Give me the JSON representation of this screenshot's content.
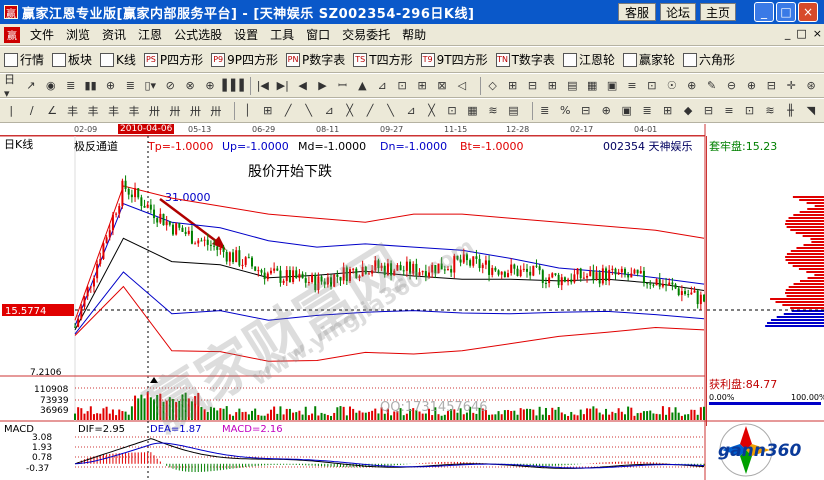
{
  "window": {
    "title": "赢家江恩专业版[赢家内部服务平台] - [天神娱乐  SZ002354-296日K线]",
    "buttons": [
      "客服",
      "论坛",
      "主页"
    ],
    "controls": [
      "_",
      "□",
      "×"
    ]
  },
  "menu": {
    "items": [
      "文件",
      "浏览",
      "资讯",
      "江恩",
      "公式选股",
      "设置",
      "工具",
      "窗口",
      "交易委托",
      "帮助"
    ],
    "right_controls": [
      "_",
      "□",
      "×"
    ]
  },
  "toolbar1": {
    "items": [
      {
        "label": "行情",
        "icon": "grid-icon"
      },
      {
        "label": "板块",
        "icon": "blocks-icon"
      },
      {
        "label": "K线",
        "icon": "candles-icon"
      },
      {
        "label": "P四方形",
        "icon": "ps-icon",
        "badge": "PS"
      },
      {
        "label": "9P四方形",
        "icon": "p9-icon",
        "badge": "P9"
      },
      {
        "label": "P数字表",
        "icon": "pn-icon",
        "badge": "PN"
      },
      {
        "label": "T四方形",
        "icon": "ts-icon",
        "badge": "TS"
      },
      {
        "label": "9T四方形",
        "icon": "t9-icon",
        "badge": "T9"
      },
      {
        "label": "T数字表",
        "icon": "tn-icon",
        "badge": "TN"
      },
      {
        "label": "江恩轮",
        "icon": "wheel-icon"
      },
      {
        "label": "赢家轮",
        "icon": "wheel2-icon"
      },
      {
        "label": "六角形",
        "icon": "hexagon-icon"
      }
    ]
  },
  "toolbar2": {
    "items": [
      "日▾",
      "↗",
      "◉",
      "≣",
      "▮▮",
      "⊕",
      "≣",
      "▯▾",
      "⊘",
      "⊗",
      "⊕",
      "▐▐▐",
      "|◀",
      "▶|",
      "◀",
      "▶",
      "ꟷ",
      "▲",
      "⊿",
      "⊡",
      "⊞",
      "⊠",
      "◁",
      "◇",
      "⊞",
      "⊟",
      "⊞",
      "▤",
      "▦",
      "▣",
      "≡",
      "⊡",
      "☉",
      "⊕",
      "✎",
      "⊖",
      "⊕",
      "⊟",
      "✛",
      "⊛"
    ]
  },
  "toolbar3": {
    "items": [
      "|",
      "∕",
      "∠",
      "丰",
      "丰",
      "丰",
      "丰",
      "卅",
      "卅",
      "卅",
      "卅",
      "│",
      "⊞",
      "╱",
      "╲",
      "⊿",
      "╳",
      "╱",
      "╲",
      "⊿",
      "╳",
      "⊡",
      "▦",
      "≋",
      "▤",
      "≣",
      "%",
      "⊟",
      "⊕",
      "▣",
      "≣",
      "⊞",
      "◆",
      "⊟",
      "≡",
      "⊡",
      "≋",
      "╫",
      "◥"
    ]
  },
  "chart": {
    "period": "日K线",
    "dates": [
      "02-09",
      "2010-04-06",
      "05-13",
      "06-29",
      "08-11",
      "09-27",
      "11-15",
      "12-28",
      "02-17",
      "04-01"
    ],
    "indicator_name": "极反通道",
    "params": [
      {
        "label": "Tp=-1.0000",
        "color": "#e00000"
      },
      {
        "label": "Up=-1.0000",
        "color": "#0000c8"
      },
      {
        "label": "Md=-1.0000",
        "color": "#000000"
      },
      {
        "label": "Dn=-1.0000",
        "color": "#0000c8"
      },
      {
        "label": "Bt=-1.0000",
        "color": "#e00000"
      }
    ],
    "stock": "002354  天神娱乐",
    "annotation": "股价开始下跌",
    "peak_label": "31.0000",
    "price_tag": "15.5774",
    "volume_labels": [
      "7.2106",
      "110908",
      "73939",
      "36969"
    ],
    "qq": "QQ:1731457646",
    "watermark": "赢家财富网",
    "watermark_url": "www.yingjia360.com"
  },
  "side": {
    "trapped": "套牢盘:15.23",
    "profit": "获利盘:84.77",
    "pct_left": "0.00%",
    "pct_right": "100.00%"
  },
  "macd": {
    "label": "MACD",
    "dif": "DIF=2.95",
    "dea": "DEA=1.87",
    "macd": "MACD=2.16",
    "ticks": [
      "3.08",
      "1.93",
      "0.78",
      "-0.37"
    ]
  },
  "logo": {
    "text": "gann360"
  },
  "colors": {
    "title_bar": "#0a58c9",
    "up": "#e00000",
    "down": "#008000",
    "accent": "#cc0000"
  },
  "series": {
    "tp": [
      14.3,
      31,
      29.5,
      28.5,
      27.5,
      27,
      26.5,
      27.5,
      27.5,
      27,
      26.5,
      26,
      25.5,
      24.5
    ],
    "up": [
      13.6,
      28.8,
      26.5,
      25.8,
      24.2,
      23.4,
      23.8,
      23.4,
      23,
      22,
      20.8,
      20.3,
      19.6,
      18.8
    ],
    "md": [
      13.1,
      24.5,
      21.6,
      21.2,
      19.6,
      19.9,
      20.4,
      19.8,
      19.4,
      19.4,
      19.2,
      19.4,
      18.9,
      18
    ],
    "dn": [
      12.6,
      20.3,
      15.1,
      15.5,
      14.3,
      14.9,
      15.3,
      15.5,
      15.2,
      15.1,
      15.3,
      15.4,
      15,
      14.5
    ],
    "bt": [
      12.4,
      18.5,
      10.5,
      10.4,
      9.2,
      9.3,
      10.3,
      10.1,
      10.5,
      11.4,
      12.3,
      12.8,
      13.4,
      13.1
    ],
    "close": [
      13.5,
      31,
      26,
      23,
      20,
      19,
      21,
      20.5,
      21.5,
      20.5,
      19.5,
      20,
      19.2,
      16.8
    ]
  }
}
